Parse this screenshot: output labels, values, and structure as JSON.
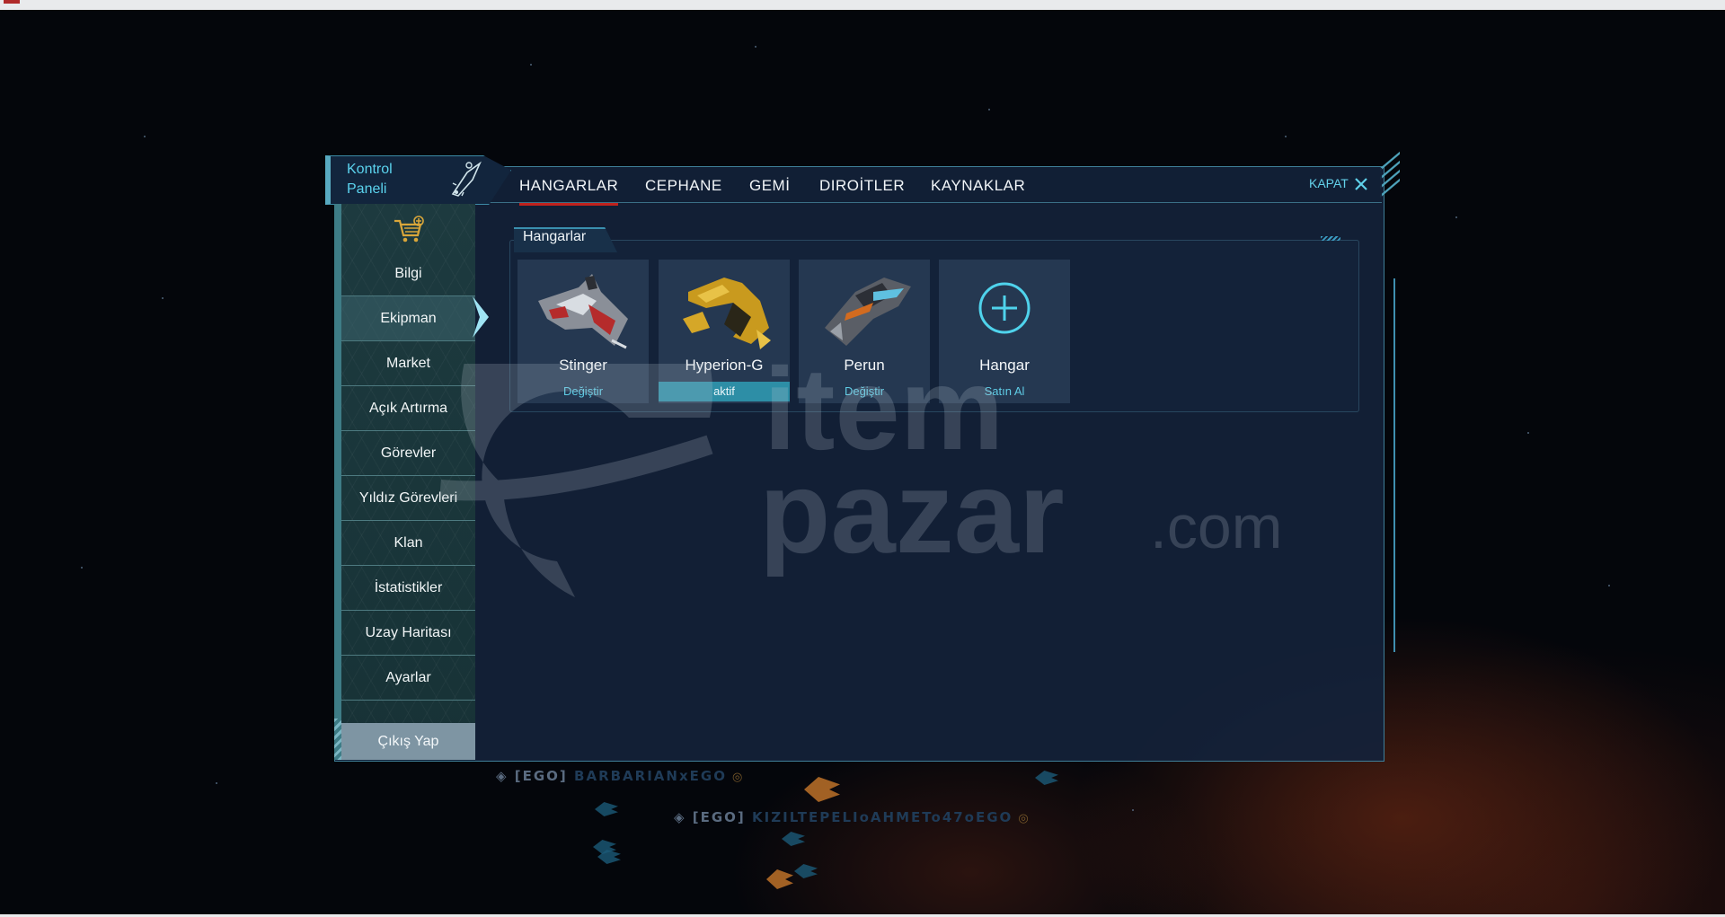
{
  "panel": {
    "title": "Kontrol Paneli",
    "close_label": "KAPAT"
  },
  "tabs": [
    {
      "label": "HANGARLAR",
      "active": true
    },
    {
      "label": "CEPHANE"
    },
    {
      "label": "GEMİ"
    },
    {
      "label": "DIROİTLER"
    },
    {
      "label": "KAYNAKLAR"
    }
  ],
  "sidebar": {
    "items": [
      {
        "label": "Bilgi"
      },
      {
        "label": "Ekipman",
        "active": true
      },
      {
        "label": "Market"
      },
      {
        "label": "Açık Artırma"
      },
      {
        "label": "Görevler"
      },
      {
        "label": "Yıldız Görevleri"
      },
      {
        "label": "Klan"
      },
      {
        "label": "İstatistikler"
      },
      {
        "label": "Uzay Haritası"
      },
      {
        "label": "Ayarlar"
      }
    ],
    "logout_label": "Çıkış Yap"
  },
  "section": {
    "title": "Hangarlar"
  },
  "hangars": [
    {
      "name": "Stinger",
      "action": "Değiştir",
      "active": false
    },
    {
      "name": "Hyperion-G",
      "action": "aktif",
      "active": true
    },
    {
      "name": "Perun",
      "action": "Değiştir",
      "active": false
    },
    {
      "name": "Hangar",
      "action": "Satın Al",
      "active": false
    }
  ],
  "watermark": {
    "text1": "item",
    "text2": "pazar",
    "text3": ".com"
  },
  "players": [
    {
      "clan": "[EGO]",
      "name": "BARBARIANxEGO"
    },
    {
      "clan": "[EGO]",
      "name": "KIZILTEPELIoAHMETo47oEGO"
    }
  ],
  "colors": {
    "accent": "#5bd3ee",
    "active_tab_underline": "#c0221d",
    "panel_bg": "#14223a"
  }
}
